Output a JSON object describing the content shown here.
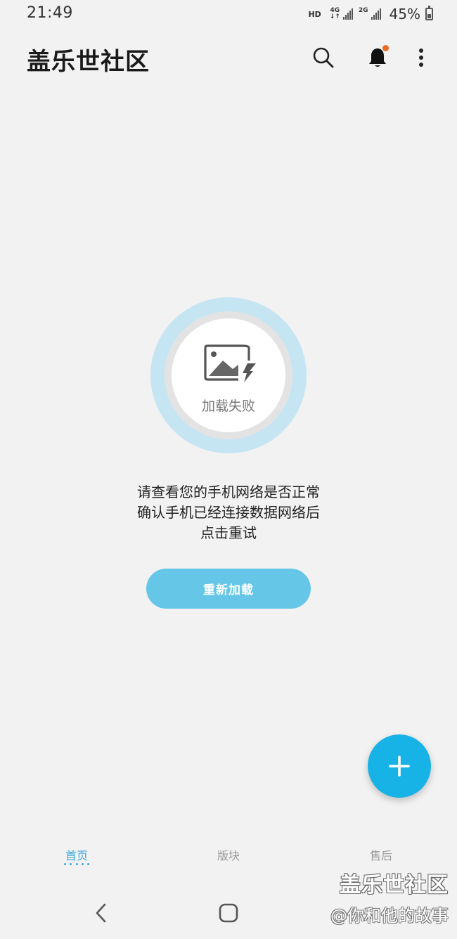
{
  "status_bar": {
    "time": "21:49",
    "hd": "HD",
    "network1": "4G",
    "network2": "2G",
    "battery": "45%",
    "battery_level": 0.45
  },
  "app_bar": {
    "title": "盖乐世社区",
    "icons": [
      "search-icon",
      "bell-icon",
      "more-vert-icon"
    ],
    "notification_dot_color": "#ee6a20"
  },
  "error_state": {
    "badge_label": "加载失败",
    "message_lines": [
      "请查看您的手机网络是否正常",
      "确认手机已经连接数据网络后",
      "点击重试"
    ],
    "reload_label": "重新加载",
    "ring_color": "#c6e5f3",
    "button_color": "#66c6e8"
  },
  "fab": {
    "icon": "plus-icon",
    "color": "#18b3e6"
  },
  "bottom_nav": {
    "items": [
      {
        "label": "首页",
        "active": true
      },
      {
        "label": "版块",
        "active": false
      },
      {
        "label": "售后",
        "active": false
      }
    ],
    "active_color": "#3aa7dd"
  },
  "watermark": {
    "title": "盖乐世社区",
    "credit": "@你和他的故事"
  },
  "system_nav": {
    "icons": [
      "back-icon",
      "home-icon"
    ]
  }
}
